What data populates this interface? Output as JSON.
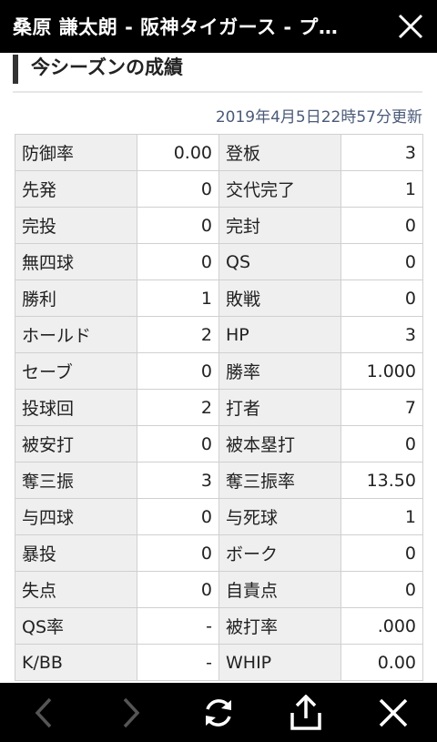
{
  "header": {
    "title": "桑原 謙太朗 - 阪神タイガース - プ…"
  },
  "section": {
    "title": "今シーズンの成績",
    "updated": "2019年4月5日22時57分更新"
  },
  "stats": [
    {
      "l1": "防御率",
      "v1": "0.00",
      "l2": "登板",
      "v2": "3"
    },
    {
      "l1": "先発",
      "v1": "0",
      "l2": "交代完了",
      "v2": "1"
    },
    {
      "l1": "完投",
      "v1": "0",
      "l2": "完封",
      "v2": "0"
    },
    {
      "l1": "無四球",
      "v1": "0",
      "l2": "QS",
      "v2": "0"
    },
    {
      "l1": "勝利",
      "v1": "1",
      "l2": "敗戦",
      "v2": "0"
    },
    {
      "l1": "ホールド",
      "v1": "2",
      "l2": "HP",
      "v2": "3"
    },
    {
      "l1": "セーブ",
      "v1": "0",
      "l2": "勝率",
      "v2": "1.000"
    },
    {
      "l1": "投球回",
      "v1": "2",
      "l2": "打者",
      "v2": "7"
    },
    {
      "l1": "被安打",
      "v1": "0",
      "l2": "被本塁打",
      "v2": "0"
    },
    {
      "l1": "奪三振",
      "v1": "3",
      "l2": "奪三振率",
      "v2": "13.50"
    },
    {
      "l1": "与四球",
      "v1": "0",
      "l2": "与死球",
      "v2": "1"
    },
    {
      "l1": "暴投",
      "v1": "0",
      "l2": "ボーク",
      "v2": "0"
    },
    {
      "l1": "失点",
      "v1": "0",
      "l2": "自責点",
      "v2": "0"
    },
    {
      "l1": "QS率",
      "v1": "-",
      "l2": "被打率",
      "v2": ".000"
    },
    {
      "l1": "K/BB",
      "v1": "-",
      "l2": "WHIP",
      "v2": "0.00"
    }
  ],
  "toolbar": {
    "back_icon": "back-arrow-icon",
    "forward_icon": "forward-arrow-icon",
    "reload_icon": "reload-icon",
    "share_icon": "share-icon",
    "close_icon": "close-icon"
  }
}
